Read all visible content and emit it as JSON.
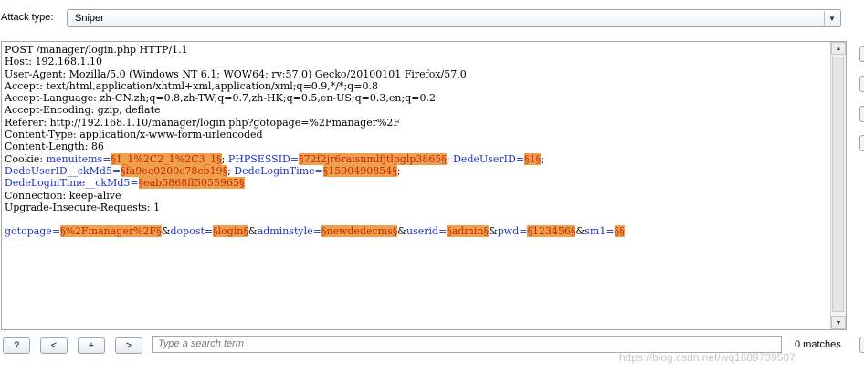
{
  "attack": {
    "label": "Attack type:",
    "selected": "Sniper"
  },
  "request_lines": [
    [
      {
        "t": "POST /manager/login.php HTTP/1.1"
      }
    ],
    [
      {
        "t": "Host: 192.168.1.10"
      }
    ],
    [
      {
        "t": "User-Agent: Mozilla/5.0 (Windows NT 6.1; WOW64; rv:57.0) Gecko/20100101 Firefox/57.0"
      }
    ],
    [
      {
        "t": "Accept: text/html,application/xhtml+xml,application/xml;q=0.9,*/*;q=0.8"
      }
    ],
    [
      {
        "t": "Accept-Language: zh-CN,zh;q=0.8,zh-TW;q=0.7,zh-HK;q=0.5,en-US;q=0.3,en;q=0.2"
      }
    ],
    [
      {
        "t": "Accept-Encoding: gzip, deflate"
      }
    ],
    [
      {
        "t": "Referer: http://192.168.1.10/manager/login.php?gotopage=%2Fmanager%2F"
      }
    ],
    [
      {
        "t": "Content-Type: application/x-www-form-urlencoded"
      }
    ],
    [
      {
        "t": "Content-Length: 86"
      }
    ],
    [
      {
        "t": "Cookie: "
      },
      {
        "t": "menuitems=",
        "c": "p"
      },
      {
        "t": "§1_1%2C2_1%2C3_1§",
        "c": "m"
      },
      {
        "t": "; "
      },
      {
        "t": "PHPSESSID=",
        "c": "p"
      },
      {
        "t": "§72f2jr6raisnmlfjtlpglp3865§",
        "c": "m"
      },
      {
        "t": "; "
      },
      {
        "t": "DedeUserID=",
        "c": "p"
      },
      {
        "t": "§1§",
        "c": "m"
      },
      {
        "t": ";"
      }
    ],
    [
      {
        "t": "DedeUserID__ckMd5=",
        "c": "p"
      },
      {
        "t": "§fa9ee0200c78cb19§",
        "c": "m"
      },
      {
        "t": "; "
      },
      {
        "t": "DedeLoginTime=",
        "c": "p"
      },
      {
        "t": "§1590490854§",
        "c": "m"
      },
      {
        "t": ";"
      }
    ],
    [
      {
        "t": "DedeLoginTime__ckMd5=",
        "c": "p"
      },
      {
        "t": "§eab5868ff5055965§",
        "c": "m"
      }
    ],
    [
      {
        "t": "Connection: keep-alive"
      }
    ],
    [
      {
        "t": "Upgrade-Insecure-Requests: 1"
      }
    ],
    [
      {
        "t": ""
      }
    ],
    [
      {
        "t": "gotopage=",
        "c": "p"
      },
      {
        "t": "§%2Fmanager%2F§",
        "c": "m"
      },
      {
        "t": "&"
      },
      {
        "t": "dopost=",
        "c": "p"
      },
      {
        "t": "§login§",
        "c": "m"
      },
      {
        "t": "&"
      },
      {
        "t": "adminstyle=",
        "c": "p"
      },
      {
        "t": "§newdedecms§",
        "c": "m"
      },
      {
        "t": "&"
      },
      {
        "t": "userid=",
        "c": "p"
      },
      {
        "t": "§admin§",
        "c": "m"
      },
      {
        "t": "&"
      },
      {
        "t": "pwd=",
        "c": "p"
      },
      {
        "t": "§123456§",
        "c": "m"
      },
      {
        "t": "&"
      },
      {
        "t": "sm1=",
        "c": "p"
      },
      {
        "t": "§§",
        "c": "m"
      }
    ]
  ],
  "toolbar": {
    "help_label": "?",
    "prev_label": "<",
    "add_label": "+",
    "next_label": ">",
    "search_placeholder": "Type a search term",
    "matches_text": "0 matches"
  },
  "watermark": "https://blog.csdn.net/wq1689739507",
  "colors": {
    "param_name": "#1f33c4",
    "payload_marker_bg": "#f0a04a",
    "payload_marker_text": "#c4260e"
  }
}
